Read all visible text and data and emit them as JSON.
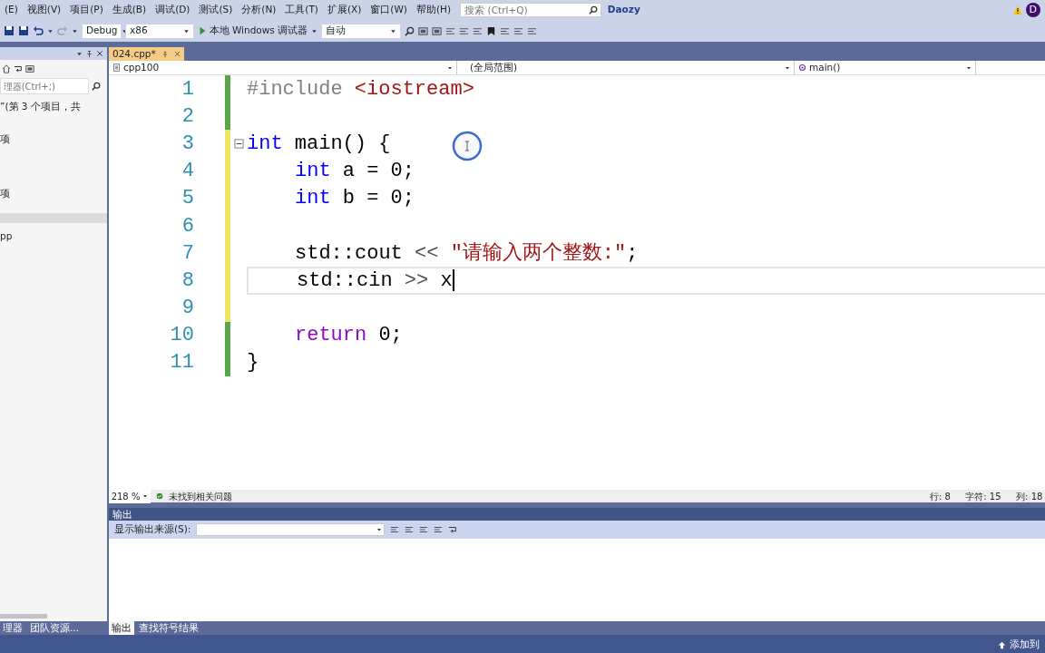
{
  "menu": [
    "(E)",
    "视图(V)",
    "项目(P)",
    "生成(B)",
    "调试(D)",
    "测试(S)",
    "分析(N)",
    "工具(T)",
    "扩展(X)",
    "窗口(W)",
    "帮助(H)"
  ],
  "search": {
    "placeholder": "搜索 (Ctrl+Q)"
  },
  "user": {
    "name": "Daozy",
    "initial": "D"
  },
  "toolbar": {
    "configuration": "Debug",
    "platform": "x86",
    "run_label": "本地 Windows 调试器",
    "run_mode": "自动"
  },
  "solution_panel": {
    "search": {
      "placeholder": "理器(Ctrl+;)"
    },
    "items": [
      {
        "text": "”(第 3 个项目，共",
        "selected": false
      },
      {
        "text": "项",
        "selected": false
      },
      {
        "text": "项",
        "selected": false
      },
      {
        "selected": true
      },
      {
        "text": "pp",
        "selected": false
      }
    ],
    "tabs": [
      {
        "label": "理器",
        "selected": false
      },
      {
        "label": "团队资源...",
        "selected": false
      }
    ]
  },
  "editor": {
    "tab": {
      "label": "024.cpp*",
      "selected": true
    },
    "nav": {
      "project": "cpp100",
      "scope": "(全局范围)",
      "member": "main()"
    },
    "lines": [
      {
        "number": "1",
        "unsaved": false,
        "indented": false,
        "tokens": [
          {
            "kind": "preproc",
            "text": "#include"
          },
          {
            "kind": "string",
            "text": " <iostream>"
          }
        ]
      },
      {
        "number": "2",
        "unsaved": false
      },
      {
        "number": "3",
        "unsaved": true,
        "indented": false,
        "fold": true,
        "tokens": [
          {
            "kind": "keyword",
            "text": "int"
          },
          {
            "kind": "plain",
            "text": " main() {"
          }
        ]
      },
      {
        "number": "4",
        "unsaved": true,
        "indented": true,
        "tokens": [
          {
            "kind": "keyword",
            "text": "int"
          },
          {
            "kind": "plain",
            "text": " a = 0;"
          }
        ]
      },
      {
        "number": "5",
        "unsaved": true,
        "indented": true,
        "tokens": [
          {
            "kind": "keyword",
            "text": "int"
          },
          {
            "kind": "plain",
            "text": " b = 0;"
          }
        ]
      },
      {
        "number": "6",
        "unsaved": true
      },
      {
        "number": "7",
        "unsaved": true,
        "indented": true,
        "tokens": [
          {
            "kind": "plain",
            "text": "std::cout "
          },
          {
            "kind": "operator",
            "text": "<<"
          },
          {
            "kind": "string",
            "text": " \"请输入两个整数:\""
          },
          {
            "kind": "plain",
            "text": ";"
          }
        ]
      },
      {
        "number": "8",
        "unsaved": true,
        "indented": true,
        "current": true,
        "tokens": [
          {
            "kind": "plain",
            "text": "std::cin "
          },
          {
            "kind": "operator",
            "text": ">>"
          },
          {
            "kind": "plain",
            "text": " x"
          }
        ]
      },
      {
        "number": "9",
        "unsaved": true
      },
      {
        "number": "10",
        "unsaved": false,
        "indented": true,
        "tokens": [
          {
            "kind": "control",
            "text": "return"
          },
          {
            "kind": "plain",
            "text": " 0;"
          }
        ]
      },
      {
        "number": "11",
        "unsaved": false,
        "indented": false,
        "tokens": [
          {
            "kind": "plain",
            "text": "}"
          }
        ]
      }
    ],
    "status": {
      "zoom": "218 %",
      "issues": "未找到相关问题",
      "line": "行: 8",
      "char": "字符: 15",
      "col": "列: 18"
    }
  },
  "output_panel": {
    "title": "输出",
    "source_label": "显示输出来源(S):",
    "tabs": [
      {
        "label": "输出",
        "selected": true
      },
      {
        "label": "查找符号结果",
        "selected": false
      }
    ]
  },
  "status_bar": {
    "action": "添加到"
  }
}
